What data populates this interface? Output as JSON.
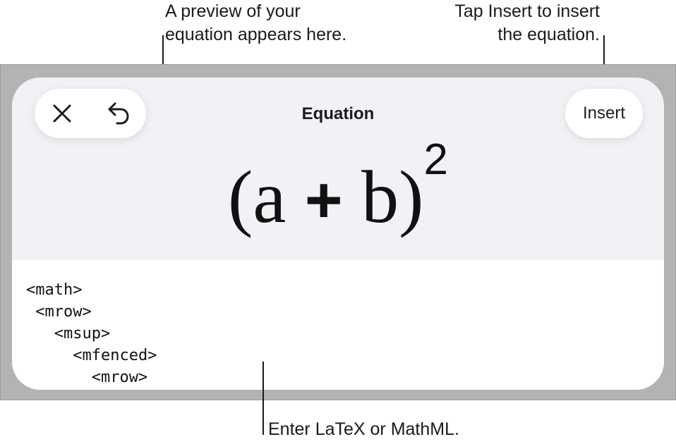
{
  "callouts": {
    "preview_line1": "A preview of your",
    "preview_line2": "equation appears here.",
    "insert_line1": "Tap Insert to insert",
    "insert_line2": "the equation.",
    "enter": "Enter LaTeX or MathML."
  },
  "header": {
    "title": "Equation",
    "insert_label": "Insert",
    "close_icon": "close-icon",
    "undo_icon": "undo-icon"
  },
  "preview": {
    "open_paren": "(",
    "var_a": "a",
    "plus": "+",
    "var_b": "b",
    "close_paren": ")",
    "exponent": "2"
  },
  "editor": {
    "lines": [
      "<math>",
      " <mrow>",
      "   <msup>",
      "     <mfenced>",
      "       <mrow>"
    ]
  }
}
